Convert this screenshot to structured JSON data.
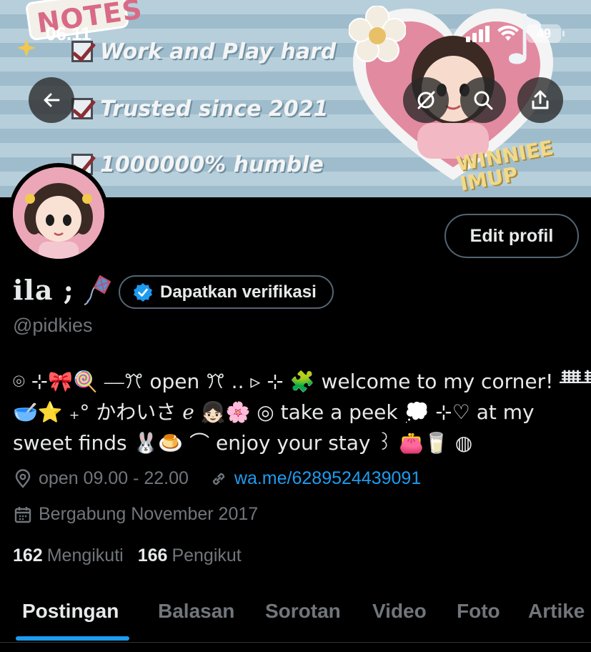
{
  "status_bar": {
    "time": "06.11",
    "battery": "49"
  },
  "banner": {
    "notes_label": "NOTES",
    "checklist": [
      "Work and Play hard",
      "Trusted since 2021",
      "1000000% humble"
    ],
    "sticker_text": "WINNIEE IMUP"
  },
  "profile": {
    "display_name": "ila ;",
    "handle": "@pidkies",
    "edit_label": "Edit profil",
    "verify_label": "Dapatkan verifikasi",
    "bio_lines": [
      "⌾ ⊹🎀🍭 ⎯⎯ꔫ open ꔫ .. ▹ ⊹ 🧩 welcome to my corner! ᚙᚙ",
      "🥣⭐ ₊° かわいさ ℯ 👧🏻🌸 ◎ take a peek 💭 ⊹♡ at my",
      "sweet finds 🐰🍮 ⌒ enjoy your stay ꒱ 👛🥛 ◍"
    ],
    "location": "open 09.00 - 22.00",
    "link": "wa.me/6289524439091",
    "joined": "Bergabung November 2017",
    "following_count": "162",
    "following_label": "Mengikuti",
    "followers_count": "166",
    "followers_label": "Pengikut"
  },
  "tabs": [
    "Postingan",
    "Balasan",
    "Sorotan",
    "Video",
    "Foto",
    "Artike"
  ],
  "colors": {
    "accent": "#1d9bf0",
    "muted": "#71767b",
    "text": "#e7e9ea",
    "background": "#000000"
  }
}
